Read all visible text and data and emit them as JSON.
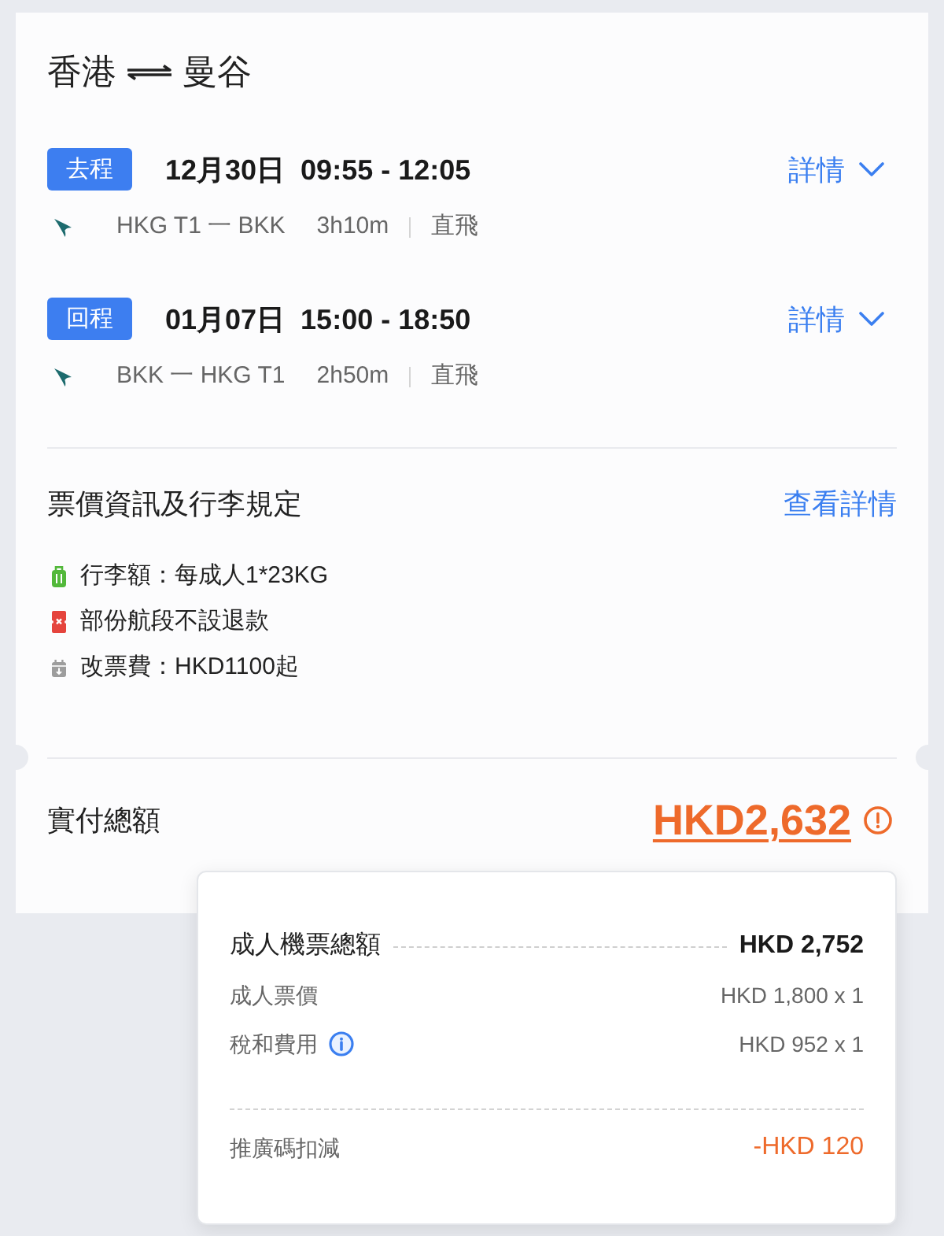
{
  "route": {
    "origin": "香港",
    "destination": "曼谷"
  },
  "flights": [
    {
      "badge": "去程",
      "date": "12月30日",
      "time": "09:55 - 12:05",
      "details_link": "詳情",
      "route": "HKG T1 一 BKK",
      "duration": "3h10m",
      "stop_type": "直飛"
    },
    {
      "badge": "回程",
      "date": "01月07日",
      "time": "15:00 - 18:50",
      "details_link": "詳情",
      "route": "BKK 一 HKG T1",
      "duration": "2h50m",
      "stop_type": "直飛"
    }
  ],
  "fare_rules": {
    "title": "票價資訊及行李規定",
    "link": "查看詳情",
    "items": [
      {
        "kind": "baggage",
        "text": "行李額：每成人1*23KG"
      },
      {
        "kind": "non-refundable",
        "text": "部份航段不設退款"
      },
      {
        "kind": "change-fee",
        "text": "改票費：HKD1100起"
      }
    ]
  },
  "total": {
    "label": "實付總額",
    "amount": "HKD2,632"
  },
  "price_breakdown": {
    "rows": [
      {
        "kind": "subtotal",
        "label": "成人機票總額",
        "value": "HKD 2,752",
        "info": false
      },
      {
        "kind": "item",
        "label": "成人票價",
        "value": "HKD 1,800 x 1",
        "info": false
      },
      {
        "kind": "item",
        "label": "稅和費用",
        "value": "HKD 952 x 1",
        "info": true
      },
      {
        "kind": "discount",
        "label": "推廣碼扣減",
        "value": "-HKD 120",
        "info": false
      }
    ]
  }
}
